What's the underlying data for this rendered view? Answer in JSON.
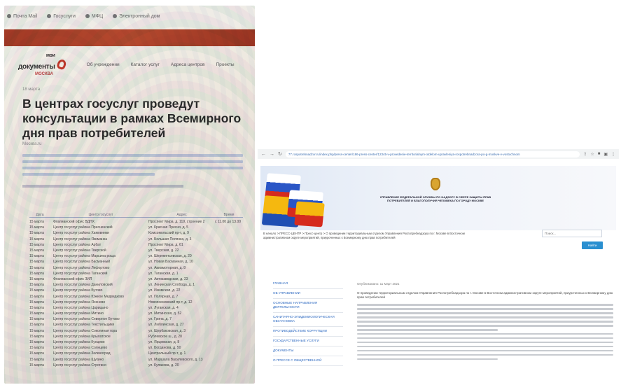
{
  "photo": {
    "bookmarks": [
      {
        "label": "Почта Mail",
        "icon": "mail-icon"
      },
      {
        "label": "Госуслуги",
        "icon": "globe-icon"
      },
      {
        "label": "МФЦ",
        "icon": "globe-icon"
      },
      {
        "label": "Электронный дом",
        "icon": "pin-icon"
      }
    ],
    "logo": {
      "text_top": "мои",
      "text_main": "документы",
      "text_sub": "МОСКВА"
    },
    "nav": [
      "Об учреждении",
      "Каталог услуг",
      "Адреса центров",
      "Проекты"
    ],
    "breadcrumb": "18 марта",
    "title": "В центрах госуслуг проведут консультации в рамках Всемирного дня прав потребителей",
    "date": "Москва.ru",
    "table": {
      "headers": [
        "Дата",
        "Центр госуслуг",
        "Адрес",
        "Время"
      ],
      "rows": [
        [
          "15 марта",
          "Флагманский офис ВДНХ",
          "Проспект Мира, д. 119, строение 2",
          "с 11.00 до 13.00"
        ],
        [
          "15 марта",
          "Центр госуслуг района Пресненский",
          "ул. Красная Пресня, д. 5",
          ""
        ],
        [
          "15 марта",
          "Центр госуслуг района Хамовники",
          "Комсомольский пр-т, д. 9",
          ""
        ],
        [
          "15 марта",
          "Центр госуслуг района Якиманка",
          "ул. Большая Полянка, д. 3",
          ""
        ],
        [
          "15 марта",
          "Центр госуслуг района Арбат",
          "Проспект Мира, д. 61",
          ""
        ],
        [
          "15 марта",
          "Центр госуслуг района Тверской",
          "ул. Тверская, д. 22",
          ""
        ],
        [
          "15 марта",
          "Центр госуслуг района Марьина роща",
          "ул. Шереметьевская, д. 20",
          ""
        ],
        [
          "15 марта",
          "Центр госуслуг района Басманный",
          "ул. Новая Басманная, д. 10",
          ""
        ],
        [
          "15 марта",
          "Центр госуслуг района Лефортово",
          "ул. Авиамоторная, д. 8",
          ""
        ],
        [
          "15 марта",
          "Центр госуслуг района Таганский",
          "ул. Таганская, д. 1",
          ""
        ],
        [
          "15 марта",
          "Флагманский офис ЗИЛ",
          "ул. Автозаводская, д. 23",
          ""
        ],
        [
          "15 марта",
          "Центр госуслуг района Даниловский",
          "ул. Ленинская Слобода, д. 1",
          ""
        ],
        [
          "15 марта",
          "Центр госуслуг района Бутово",
          "ул. Изюмская, д. 22",
          ""
        ],
        [
          "15 марта",
          "Центр госуслуг района Южное Медведково",
          "ул. Полярная, д. 7",
          ""
        ],
        [
          "15 марта",
          "Центр госуслуг района Ясенево",
          "Новоясеневский пр-т, д. 12",
          ""
        ],
        [
          "15 марта",
          "Центр госуслуг района Царицыно",
          "ул. Луганская, д. 4",
          ""
        ],
        [
          "15 марта",
          "Центр госуслуг района Митино",
          "ул. Митинская, д. 52",
          ""
        ],
        [
          "15 марта",
          "Центр госуслуг района Северное Бутово",
          "ул. Грина, д. 7",
          ""
        ],
        [
          "15 марта",
          "Центр госуслуг района Текстильщики",
          "ул. Люблинская, д. 27",
          ""
        ],
        [
          "15 марта",
          "Центр госуслуг района Соколиная гора",
          "ул. Щербаковская, д. 3",
          ""
        ],
        [
          "15 марта",
          "Центр госуслуг района Крылатское",
          "Рублевское ш., д. 28",
          ""
        ],
        [
          "15 марта",
          "Центр госуслуг района Кунцево",
          "ул. Ярцевская, д. 8",
          ""
        ],
        [
          "15 марта",
          "Центр госуслуг района Солнцево",
          "ул. Богданова, д. 50",
          ""
        ],
        [
          "15 марта",
          "Центр госуслуг района Зеленоград",
          "Центральный пр-т, д. 1",
          ""
        ],
        [
          "15 марта",
          "Центр госуслуг района Щукино",
          "ул. Маршала Василевского, д. 13",
          ""
        ],
        [
          "15 марта",
          "Центр госуслуг района Строгино",
          "ул. Кулакова, д. 20",
          ""
        ]
      ]
    }
  },
  "browser": {
    "url": "77.rospotrebnadzor.ru/index.php/press-center/186-press-center/12345-v-provedenie-territorialnym-otdelom-upravleniya-rospotrebnadzora-po-g-moskve-v-vostochnom",
    "banner_org": "УПРАВЛЕНИЕ ФЕДЕРАЛЬНОЙ СЛУЖБЫ ПО НАДЗОРУ В СФЕРЕ ЗАЩИТЫ ПРАВ ПОТРЕБИТЕЛЕЙ И БЛАГОПОЛУЧИЯ ЧЕЛОВЕКА ПО ГОРОДУ МОСКВЕ",
    "breadcrumb": "В начало > ПРЕСС-ЦЕНТР > Пресс-центр > О проведении территориальным отделом Управления Роспотребнадзора по г. Москве в Восточном административном округе мероприятий, приуроченных к Всемирному дню прав потребителей",
    "search_placeholder": "Поиск...",
    "search_button": "Найти",
    "sidebar": [
      "ГЛАВНАЯ",
      "ОБ УПРАВЛЕНИИ",
      "ОСНОВНЫЕ НАПРАВЛЕНИЯ ДЕЯТЕЛЬНОСТИ",
      "САНИТАРНО-ЭПИДЕМИОЛОГИЧЕСКАЯ ОБСТАНОВКА",
      "ПРОТИВОДЕЙСТВИЕ КОРРУПЦИИ",
      "ГОСУДАРСТВЕННЫЕ УСЛУГИ",
      "ДОКУМЕНТЫ",
      "О ПРЕССЕ С ОБЩЕСТВЕННОЙ"
    ],
    "content": {
      "date": "Опубликовано: 11 Март 2021",
      "lead": "О проведении территориальным отделом Управления Роспотребнадзора по г. Москве в Восточном административном округе мероприятий, приуроченных к Всемирному дню прав потребителей"
    }
  }
}
